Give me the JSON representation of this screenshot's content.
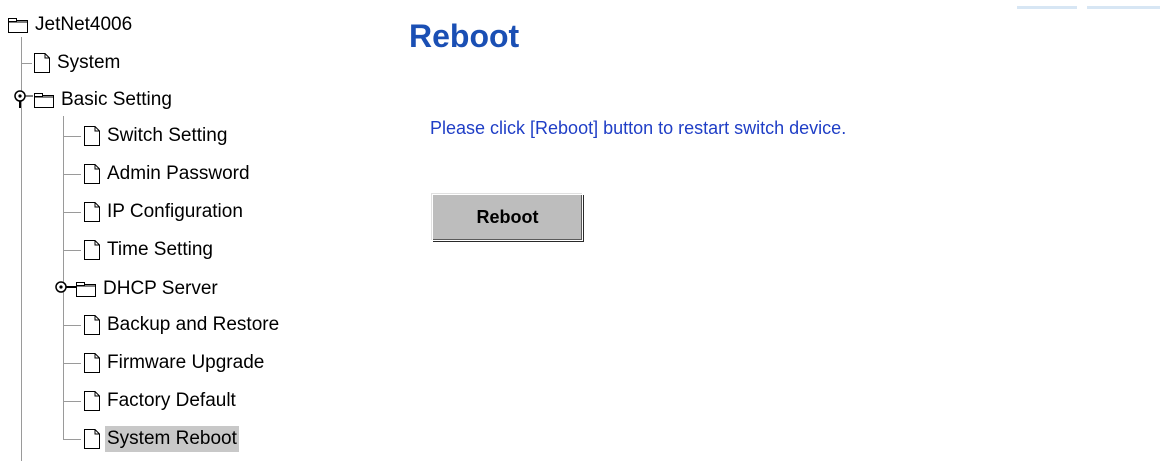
{
  "tree": {
    "root": {
      "label": "JetNet4006",
      "icon": "folder-icon"
    },
    "items": [
      {
        "label": "System",
        "icon": "page-icon"
      },
      {
        "label": "Basic Setting",
        "icon": "folder-icon",
        "expanded": true
      },
      {
        "label": "Switch Setting",
        "icon": "page-icon"
      },
      {
        "label": "Admin Password",
        "icon": "page-icon"
      },
      {
        "label": "IP Configuration",
        "icon": "page-icon"
      },
      {
        "label": "Time Setting",
        "icon": "page-icon"
      },
      {
        "label": "DHCP Server",
        "icon": "folder-icon",
        "expanded": false
      },
      {
        "label": "Backup and Restore",
        "icon": "page-icon"
      },
      {
        "label": "Firmware Upgrade",
        "icon": "page-icon"
      },
      {
        "label": "Factory Default",
        "icon": "page-icon"
      },
      {
        "label": "System Reboot",
        "icon": "page-icon",
        "selected": true
      }
    ]
  },
  "main": {
    "title": "Reboot",
    "message": "Please click [Reboot] button to restart switch device.",
    "reboot_button_label": "Reboot"
  },
  "colors": {
    "title": "#1a4fb4",
    "message": "#1f3ec6",
    "button_face": "#bdbdbd",
    "selected_bg": "#c8c8c8"
  }
}
